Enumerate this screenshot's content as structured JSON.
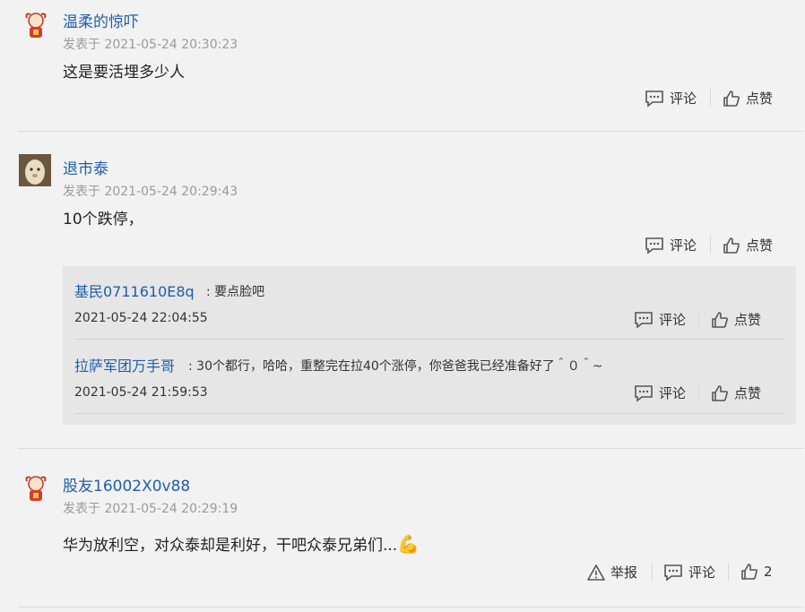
{
  "comments": [
    {
      "username": "温柔的惊吓",
      "meta": "发表于 2021-05-24 20:30:23",
      "content": "这是要活埋多少人",
      "actions": {
        "comment": "评论",
        "like": "点赞"
      }
    },
    {
      "username": "退市泰",
      "meta": "发表于 2021-05-24 20:29:43",
      "content": "10个跌停，",
      "actions": {
        "comment": "评论",
        "like": "点赞"
      },
      "replies": [
        {
          "username": "基民0711610E8q",
          "text": ": 要点脸吧",
          "date": "2021-05-24 22:04:55",
          "comment": "评论",
          "like": "点赞"
        },
        {
          "username": "拉萨军团万手哥",
          "text": ": 30个都行，哈哈，重整完在拉40个涨停，你爸爸我已经准备好了＾０＾~",
          "date": "2021-05-24 21:59:53",
          "comment": "评论",
          "like": "点赞"
        }
      ]
    },
    {
      "username": "股友16002X0v88",
      "meta": "发表于 2021-05-24 20:29:19",
      "content": "华为放利空，对众泰却是利好，干吧众泰兄弟们...",
      "emoji": "💪",
      "actions": {
        "report": "举报",
        "comment": "评论",
        "like_count": "2"
      }
    }
  ],
  "icons": {
    "comment": "comment-icon",
    "like": "thumbs-up-icon",
    "report": "warning-icon"
  },
  "colors": {
    "username": "#1f5ea8",
    "meta": "#9a9a9a",
    "background": "#f2f2f2"
  }
}
